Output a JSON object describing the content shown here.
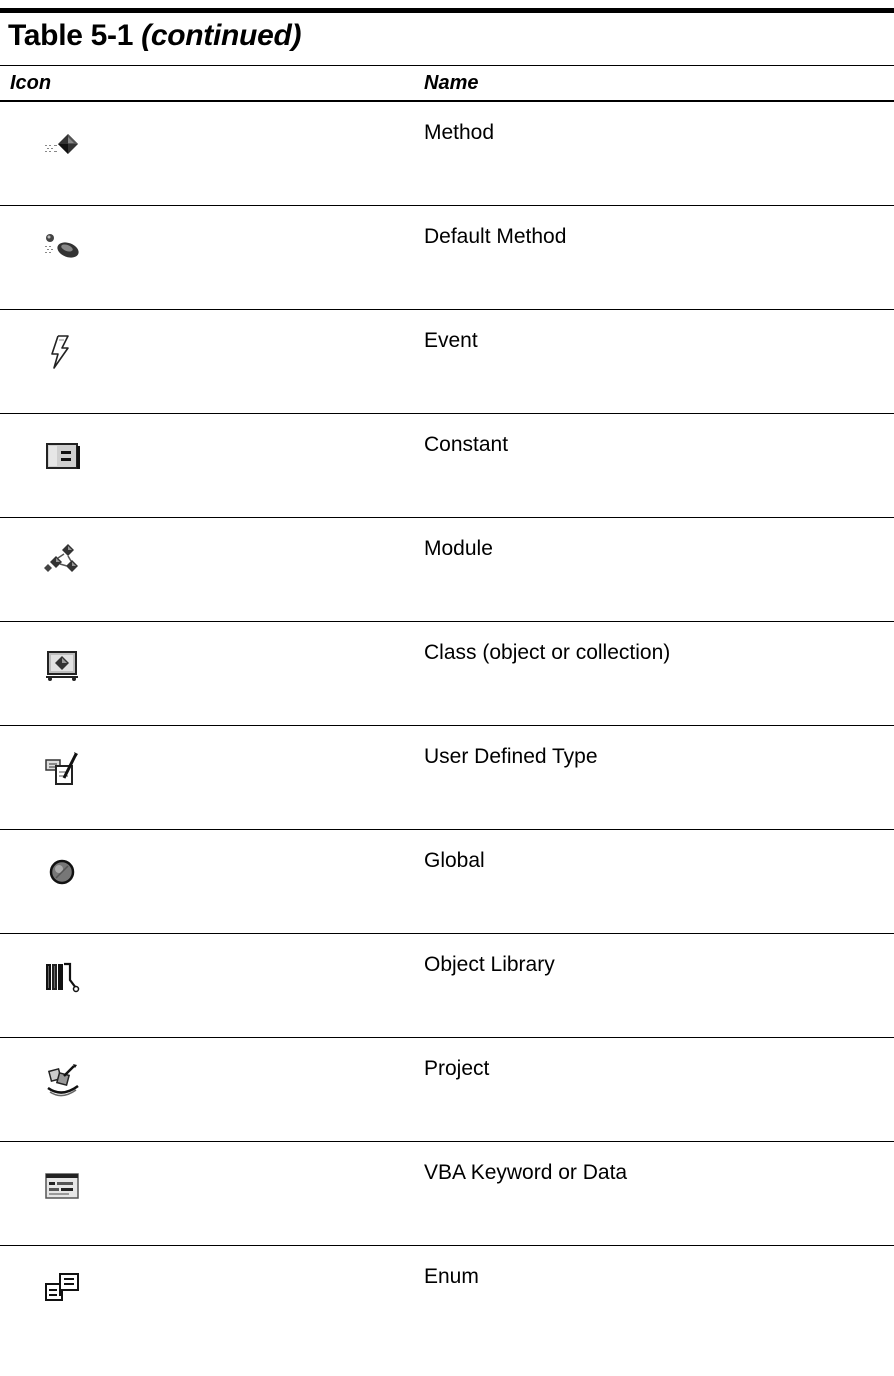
{
  "table": {
    "label": "Table 5-1",
    "label_suffix": "(continued)",
    "headers": {
      "icon": "Icon",
      "name": "Name"
    },
    "rows": [
      {
        "icon": "method-icon",
        "name": "Method"
      },
      {
        "icon": "default-method-icon",
        "name": "Default Method"
      },
      {
        "icon": "event-icon",
        "name": "Event"
      },
      {
        "icon": "constant-icon",
        "name": "Constant"
      },
      {
        "icon": "module-icon",
        "name": "Module"
      },
      {
        "icon": "class-icon",
        "name": "Class (object or collection)"
      },
      {
        "icon": "user-defined-type-icon",
        "name": "User Defined Type"
      },
      {
        "icon": "global-icon",
        "name": "Global"
      },
      {
        "icon": "object-library-icon",
        "name": "Object Library"
      },
      {
        "icon": "project-icon",
        "name": "Project"
      },
      {
        "icon": "vba-keyword-icon",
        "name": "VBA Keyword or Data"
      },
      {
        "icon": "enum-icon",
        "name": "Enum"
      }
    ]
  }
}
